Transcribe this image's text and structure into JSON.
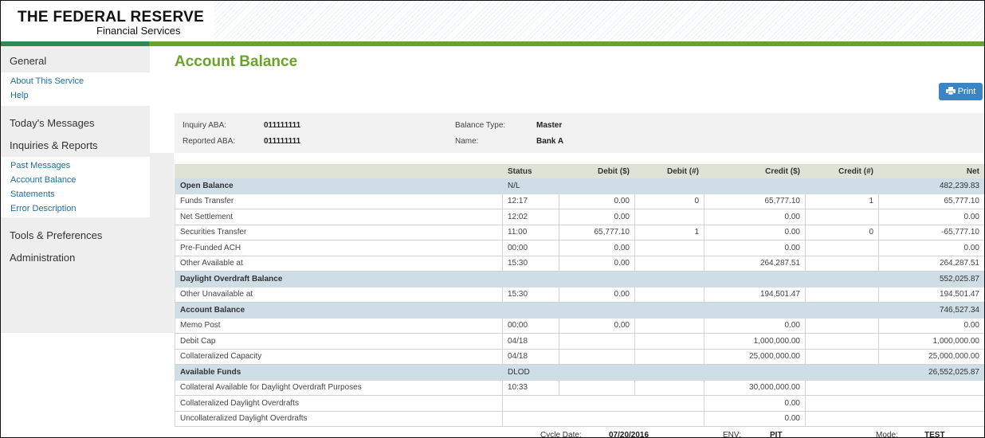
{
  "header": {
    "logo_line1": "THE FEDERAL RESERVE",
    "logo_line2": "Financial Services"
  },
  "sidebar": {
    "general": "General",
    "general_links": [
      "About This Service",
      "Help"
    ],
    "todays_messages": "Today's Messages",
    "inquiries_reports": "Inquiries & Reports",
    "report_links": [
      "Past Messages",
      "Account Balance",
      "Statements",
      "Error Description"
    ],
    "tools_preferences": "Tools & Preferences",
    "administration": "Administration"
  },
  "main": {
    "title": "Account Balance",
    "print_label": "Print"
  },
  "info": {
    "inquiry_aba_label": "Inquiry ABA:",
    "inquiry_aba": "011111111",
    "reported_aba_label": "Reported ABA:",
    "reported_aba": "011111111",
    "balance_type_label": "Balance Type:",
    "balance_type": "Master",
    "name_label": "Name:",
    "name": "Bank A"
  },
  "table": {
    "headers": [
      "",
      "Status",
      "Debit ($)",
      "Debit (#)",
      "Credit ($)",
      "Credit (#)",
      "Net"
    ],
    "rows": [
      {
        "section": true,
        "label": "Open Balance",
        "status": "N/L",
        "debit_amt": "",
        "debit_cnt": "",
        "credit_amt": "",
        "credit_cnt": "",
        "net": "482,239.83"
      },
      {
        "label": "Funds Transfer",
        "status": "12:17",
        "debit_amt": "0.00",
        "debit_cnt": "0",
        "credit_amt": "65,777.10",
        "credit_cnt": "1",
        "net": "65,777.10"
      },
      {
        "label": "Net Settlement",
        "status": "12:02",
        "debit_amt": "0.00",
        "debit_cnt": "",
        "credit_amt": "0.00",
        "credit_cnt": "",
        "net": "0.00"
      },
      {
        "label": "Securities Transfer",
        "status": "11:00",
        "debit_amt": "65,777.10",
        "debit_cnt": "1",
        "credit_amt": "0.00",
        "credit_cnt": "0",
        "net": "-65,777.10"
      },
      {
        "label": "Pre-Funded ACH",
        "status": "00:00",
        "debit_amt": "0.00",
        "debit_cnt": "",
        "credit_amt": "0.00",
        "credit_cnt": "",
        "net": "0.00"
      },
      {
        "label": "Other Available at",
        "status": "15:30",
        "debit_amt": "0.00",
        "debit_cnt": "",
        "credit_amt": "264,287.51",
        "credit_cnt": "",
        "net": "264,287.51"
      },
      {
        "section": true,
        "label": "Daylight Overdraft Balance",
        "status": "",
        "debit_amt": "",
        "debit_cnt": "",
        "credit_amt": "",
        "credit_cnt": "",
        "net": "552,025.87"
      },
      {
        "label": "Other Unavailable at",
        "status": "15:30",
        "debit_amt": "0.00",
        "debit_cnt": "",
        "credit_amt": "194,501.47",
        "credit_cnt": "",
        "net": "194,501.47"
      },
      {
        "section": true,
        "label": "Account Balance",
        "status": "",
        "debit_amt": "",
        "debit_cnt": "",
        "credit_amt": "",
        "credit_cnt": "",
        "net": "746,527.34"
      },
      {
        "label": "Memo Post",
        "status": "00:00",
        "debit_amt": "0.00",
        "debit_cnt": "",
        "credit_amt": "0.00",
        "credit_cnt": "",
        "net": "0.00"
      },
      {
        "label": "Debit Cap",
        "status": "04/18",
        "debit_amt": "",
        "debit_cnt": "",
        "credit_amt": "1,000,000.00",
        "credit_cnt": "",
        "net": "1,000,000.00"
      },
      {
        "label": "Collateralized Capacity",
        "status": "04/18",
        "debit_amt": "",
        "debit_cnt": "",
        "credit_amt": "25,000,000.00",
        "credit_cnt": "",
        "net": "25,000,000.00"
      },
      {
        "section": true,
        "label": "Available Funds",
        "status": "DLOD",
        "debit_amt": "",
        "debit_cnt": "",
        "credit_amt": "",
        "credit_cnt": "",
        "net": "26,552,025.87"
      },
      {
        "label": "Collateral Available for Daylight Overdraft Purposes",
        "status": "10:33",
        "debit_amt": "",
        "debit_cnt": "",
        "credit_amt": "30,000,000.00",
        "credit_cnt": "",
        "net": ""
      },
      {
        "label": "Collateralized Daylight Overdrafts",
        "status": "",
        "debit_amt": "",
        "debit_cnt": "",
        "credit_amt": "0.00",
        "credit_cnt": "",
        "net": "",
        "merged": true
      },
      {
        "label": "Uncollateralized Daylight Overdrafts",
        "status": "",
        "debit_amt": "",
        "debit_cnt": "",
        "credit_amt": "0.00",
        "credit_cnt": "",
        "net": "",
        "merged": true
      }
    ]
  },
  "footer": {
    "cycle_date_label": "Cycle Date:",
    "cycle_date": "07/20/2016",
    "env_label": "ENV:",
    "env": "PIT",
    "mode_label": "Mode:",
    "mode": "TEST"
  },
  "colors": {
    "accent_green": "#6aa32a",
    "link_blue": "#1f6f9f",
    "print_button": "#3a85c4",
    "section_row": "#cfdde7"
  },
  "icons": {
    "print": "printer-icon"
  }
}
